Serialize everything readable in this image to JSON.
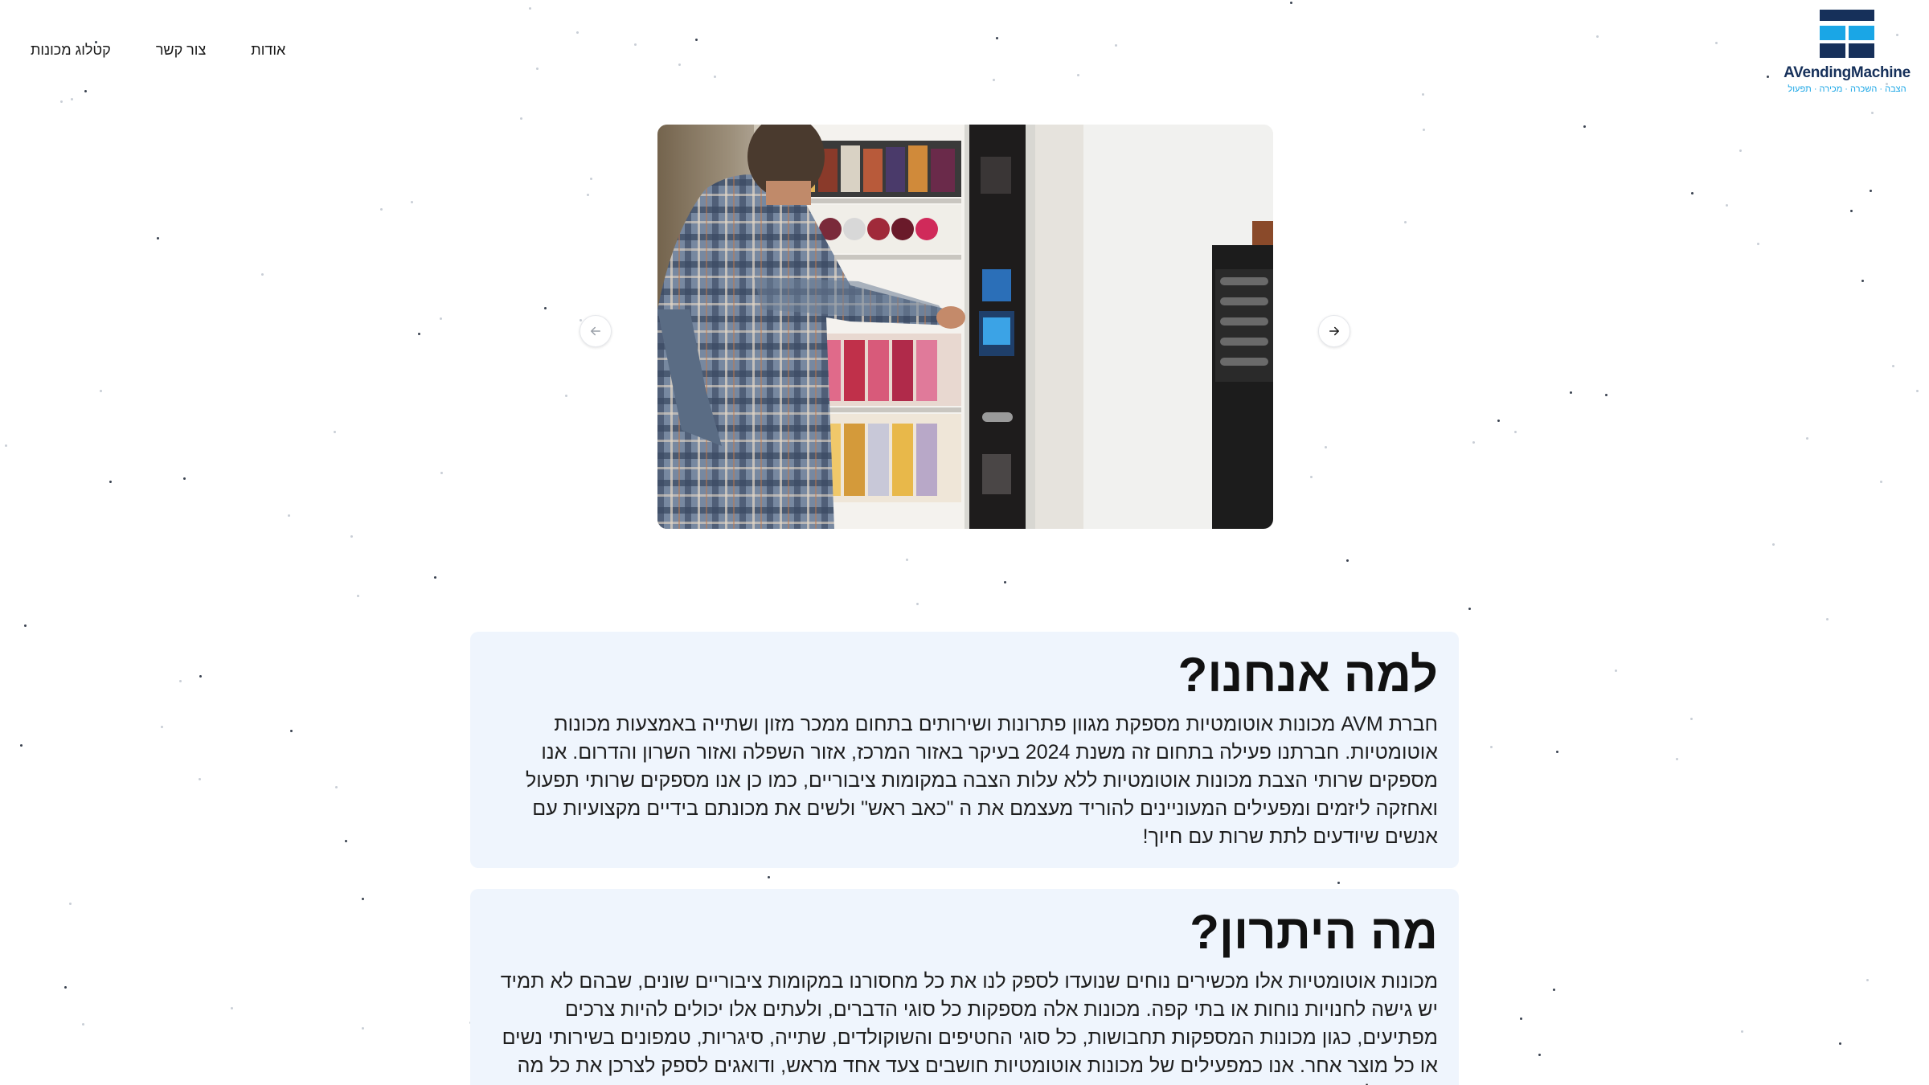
{
  "nav": {
    "catalog": "קטלוג מכונות",
    "contact": "צור קשר",
    "about": "אודות"
  },
  "logo": {
    "name": "AVendingMachine",
    "tagline": "הצבה · השכרה · מכירה · תפעול",
    "colors": {
      "dark": "#16305a",
      "accent": "#1aa6e6"
    }
  },
  "carousel": {
    "prev_icon": "arrow-left-icon",
    "next_icon": "arrow-right-icon"
  },
  "sections": [
    {
      "title": "למה אנחנו?",
      "body": "חברת AVM מכונות אוטומטיות מספקת מגוון פתרונות ושירותים בתחום ממכר מזון ושתייה באמצעות מכונות אוטומטיות. חברתנו פעילה בתחום זה משנת 2024 בעיקר באזור המרכז, אזור השפלה ואזור השרון והדרום. אנו מספקים שרותי הצבת מכונות אוטומטיות ללא עלות הצבה במקומות ציבוריים, כמו כן אנו מספקים שרותי תפעול ואחזקה ליזמים ומפעילים המעוניינים להוריד מעצמם את ה \"כאב ראש\" ולשים את מכונתם בידיים מקצועיות עם אנשים שיודעים לתת שרות עם חיוך!"
    },
    {
      "title": "מה היתרון?",
      "body": "מכונות אוטומטיות אלו מכשירים נוחים שנועדו לספק לנו את כל מחסורנו במקומות ציבוריים שונים, שבהם לא תמיד יש גישה לחנויות נוחות או בתי קפה. מכונות אלה מספקות כל סוגי הדברים, ולעתים אלו יכולים להיות צרכים מפתיעים, כגון מכונות המספקות תחבושות, כל סוגי החטיפים והשוקולדים, שתייה, סיגריות, טמפונים בשירותי נשים או כל מוצר אחר. אנו כמפעילים של מכונות אוטומטיות חושבים צעד אחד מראש, ודואגים לספק לצרכן את כל מה שדרוש לו, עוד"
    }
  ]
}
